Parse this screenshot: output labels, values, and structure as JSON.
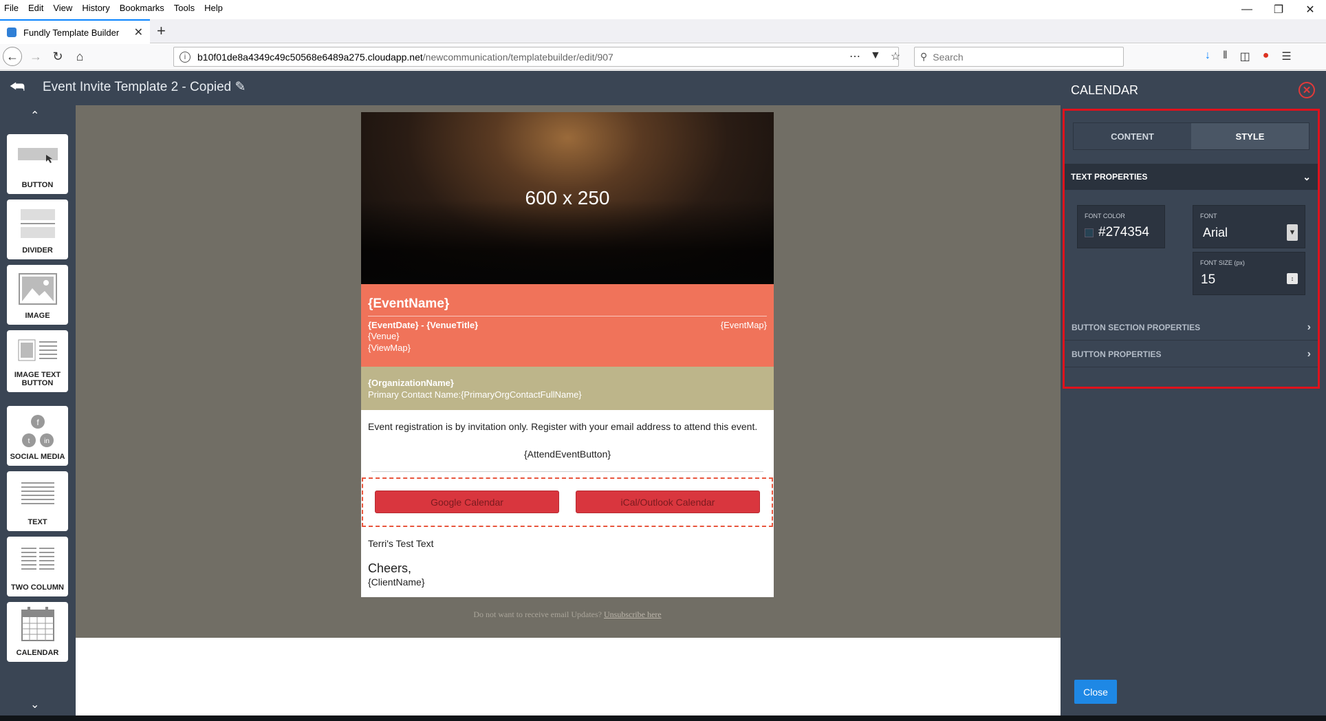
{
  "browser": {
    "menu": [
      "File",
      "Edit",
      "View",
      "History",
      "Bookmarks",
      "Tools",
      "Help"
    ],
    "tab_title": "Fundly Template Builder",
    "url_host": "b10f01de8a4349c49c50568e6489a275.cloudapp.net",
    "url_path": "/newcommunication/templatebuilder/edit/907",
    "search_placeholder": "Search"
  },
  "app": {
    "template_title": "Event Invite Template 2 - Copied"
  },
  "palette": {
    "items": [
      {
        "label": "BUTTON",
        "icon": "button-icon"
      },
      {
        "label": "DIVIDER",
        "icon": "divider-icon"
      },
      {
        "label": "IMAGE",
        "icon": "image-icon"
      },
      {
        "label": "IMAGE TEXT BUTTON",
        "icon": "image-text-button-icon"
      },
      {
        "label": "SOCIAL MEDIA",
        "icon": "social-media-icon"
      },
      {
        "label": "TEXT",
        "icon": "text-icon"
      },
      {
        "label": "TWO COLUMN",
        "icon": "two-column-icon"
      },
      {
        "label": "CALENDAR",
        "icon": "calendar-icon"
      }
    ]
  },
  "email": {
    "hero_text": "600 x 250",
    "event_name": "{EventName}",
    "event_date_venue": "{EventDate} - {VenueTitle}",
    "event_map": "{EventMap}",
    "venue": "{Venue}",
    "view_map": "{ViewMap}",
    "org_name": "{OrganizationName}",
    "primary_contact": "Primary Contact Name:{PrimaryOrgContactFullName}",
    "registration_text": "Event registration is by invitation only. Register with your email address to attend this event.",
    "attend_button": "{AttendEventButton}",
    "google_calendar": "Google Calendar",
    "ical_calendar": "iCal/Outlook Calendar",
    "test_text": "Terri's Test Text",
    "cheers": "Cheers,",
    "client_name": "{ClientName}",
    "unsub_prefix": "Do not want to receive email Updates?",
    "unsub_link": "Unsubscribe here"
  },
  "panel": {
    "title": "CALENDAR",
    "tabs": {
      "content": "CONTENT",
      "style": "STYLE",
      "active": "STYLE"
    },
    "text_properties": "TEXT PROPERTIES",
    "font_color_label": "FONT COLOR",
    "font_color_value": "#274354",
    "font_label": "FONT",
    "font_value": "Arial",
    "font_size_label": "FONT SIZE (px)",
    "font_size_value": "15",
    "button_section_properties": "BUTTON SECTION PROPERTIES",
    "button_properties": "BUTTON PROPERTIES",
    "close_button": "Close"
  },
  "colors": {
    "app_dark": "#3a4554",
    "event_block": "#f0735a",
    "org_block": "#bdb58a",
    "calendar_button": "#d9363e",
    "highlight": "#e0121c",
    "close_blue": "#1e88e5"
  }
}
